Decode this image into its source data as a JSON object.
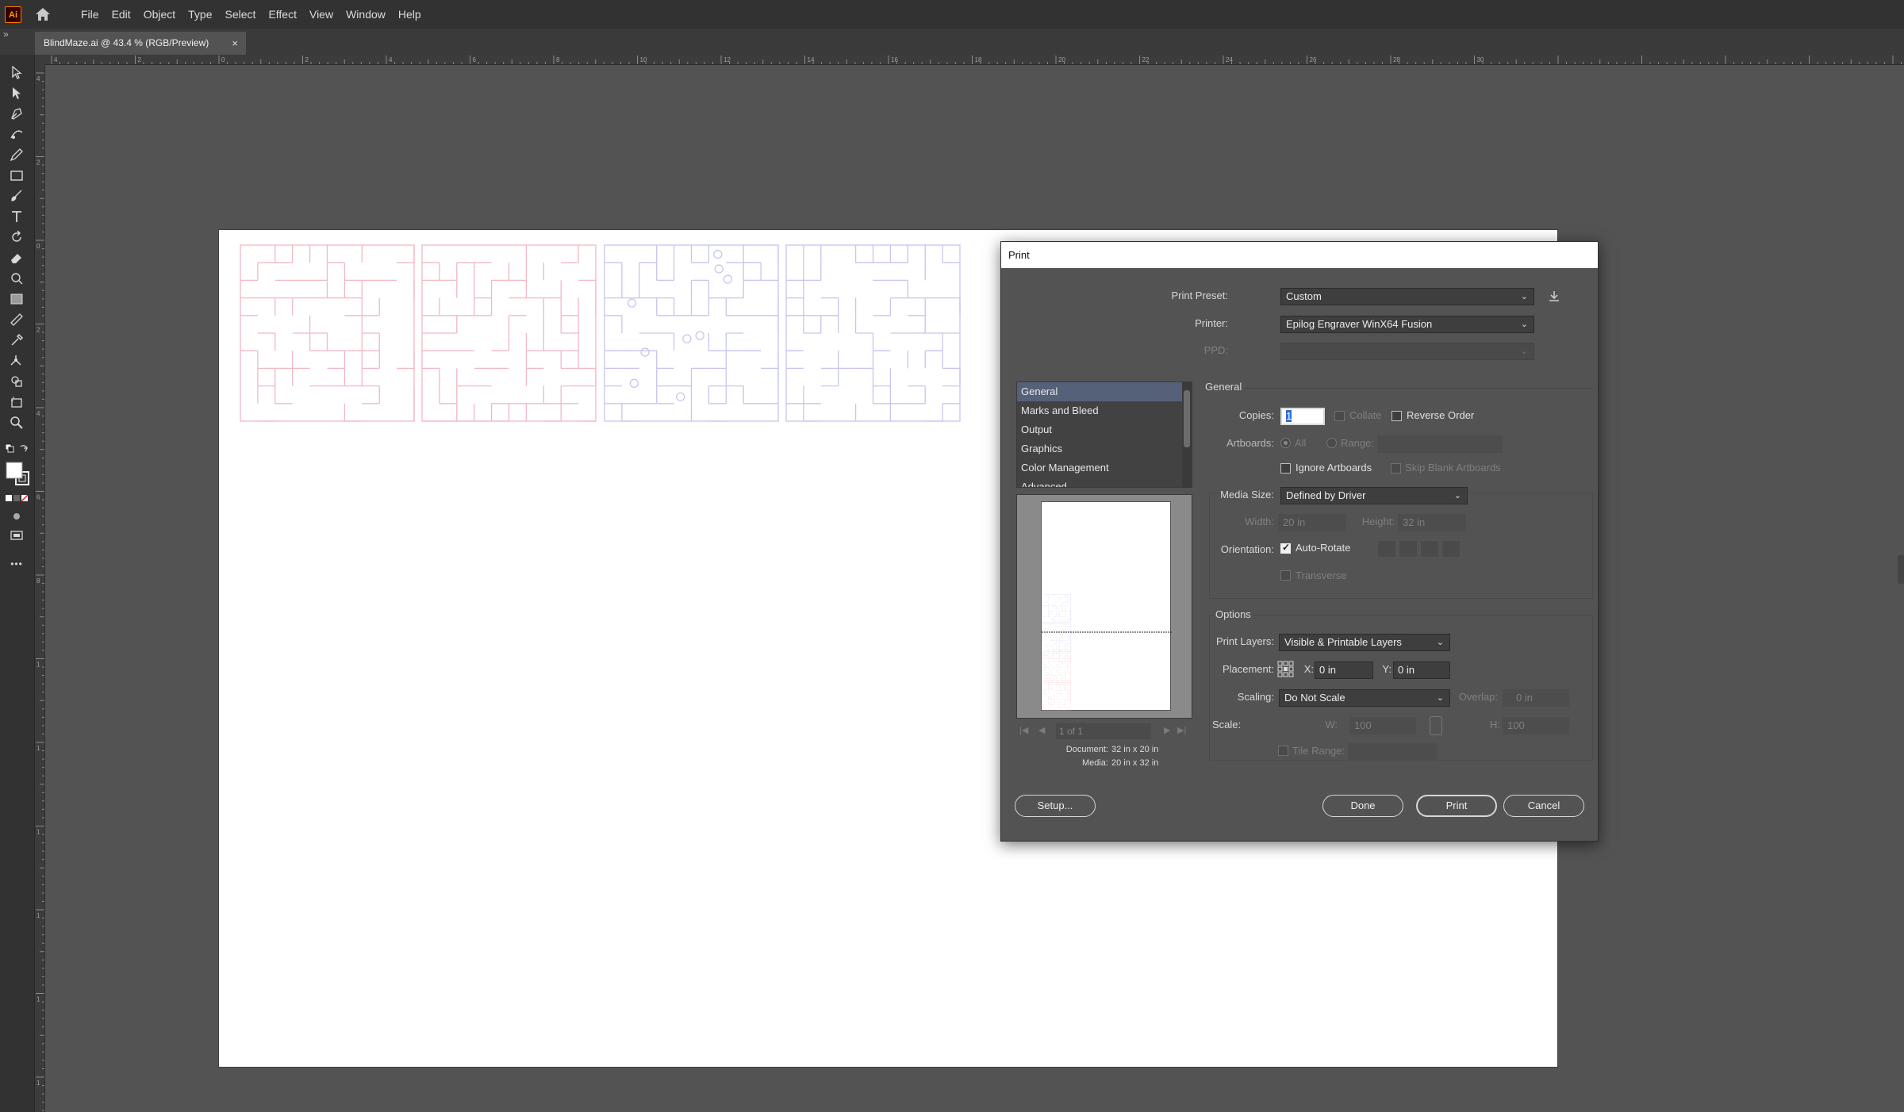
{
  "app": {
    "logo": "Ai",
    "menus": [
      "File",
      "Edit",
      "Object",
      "Type",
      "Select",
      "Effect",
      "View",
      "Window",
      "Help"
    ]
  },
  "document": {
    "tab_title": "BlindMaze.ai @ 43.4 % (RGB/Preview)",
    "close_glyph": "×",
    "panel_toggle": "»"
  },
  "rulers": {
    "top_ticks": [
      "4",
      "2",
      "0",
      "2",
      "4",
      "6",
      "8",
      "10",
      "12",
      "14",
      "16",
      "18",
      "20",
      "22",
      "24",
      "26",
      "28",
      "30"
    ],
    "left_ticks": [
      "4",
      "2",
      "0",
      "2",
      "4",
      "6",
      "8",
      "1",
      "1",
      "1",
      "1",
      "1",
      "1"
    ]
  },
  "toolbar": {
    "tools": [
      "selection-tool",
      "direct-selection-tool",
      "pen-tool",
      "curvature-tool",
      "pencil-tool",
      "rectangle-tool",
      "paintbrush-tool",
      "type-tool",
      "rotate-tool",
      "eraser-tool",
      "warp-tool",
      "gradient-tool",
      "eyedropper-tool",
      "measure-tool",
      "blend-tool",
      "puppet-warp-tool",
      "shape-builder-tool",
      "artboard-tool",
      "zoom-tool"
    ],
    "more_glyph": "•••"
  },
  "print_dialog": {
    "title": "Print",
    "print_preset_label": "Print Preset:",
    "print_preset_value": "Custom",
    "printer_label": "Printer:",
    "printer_value": "Epilog Engraver WinX64 Fusion",
    "ppd_label": "PPD:",
    "ppd_value": "",
    "categories": [
      "General",
      "Marks and Bleed",
      "Output",
      "Graphics",
      "Color Management",
      "Advanced"
    ],
    "selected_category": "General",
    "section_title": "General",
    "copies_label": "Copies:",
    "copies_value": "1",
    "collate_label": "Collate",
    "reverse_order_label": "Reverse Order",
    "artboards_label": "Artboards:",
    "artboards_all_label": "All",
    "artboards_range_label": "Range:",
    "ignore_artboards_label": "Ignore Artboards",
    "skip_blank_label": "Skip Blank Artboards",
    "media_size_label": "Media Size:",
    "media_size_value": "Defined by Driver",
    "width_label": "Width:",
    "width_value": "20 in",
    "height_label": "Height:",
    "height_value": "32 in",
    "orientation_label": "Orientation:",
    "auto_rotate_label": "Auto-Rotate",
    "auto_rotate_checked": true,
    "transverse_label": "Transverse",
    "options_title": "Options",
    "print_layers_label": "Print Layers:",
    "print_layers_value": "Visible & Printable Layers",
    "placement_label": "Placement:",
    "x_label": "X:",
    "x_value": "0 in",
    "y_label": "Y:",
    "y_value": "0 in",
    "scaling_label": "Scaling:",
    "scaling_value": "Do Not Scale",
    "overlap_label": "Overlap:",
    "overlap_value": "0 in",
    "scale_label": "Scale:",
    "scale_w_label": "W:",
    "scale_w_value": "100",
    "scale_h_label": "H:",
    "scale_h_value": "100",
    "tile_range_label": "Tile Range:",
    "page_indicator": "1 of 1",
    "document_size_label": "Document:",
    "document_size": "32 in x 20 in",
    "media_label": "Media:",
    "media_size_text": "20 in x 32 in",
    "setup_button": "Setup...",
    "done_button": "Done",
    "print_button": "Print",
    "cancel_button": "Cancel"
  },
  "colors": {
    "maze_red": "#f2b8c2",
    "maze_blue": "#c6c6ee",
    "selected_row": "#546178",
    "app_bg": "#535353"
  }
}
